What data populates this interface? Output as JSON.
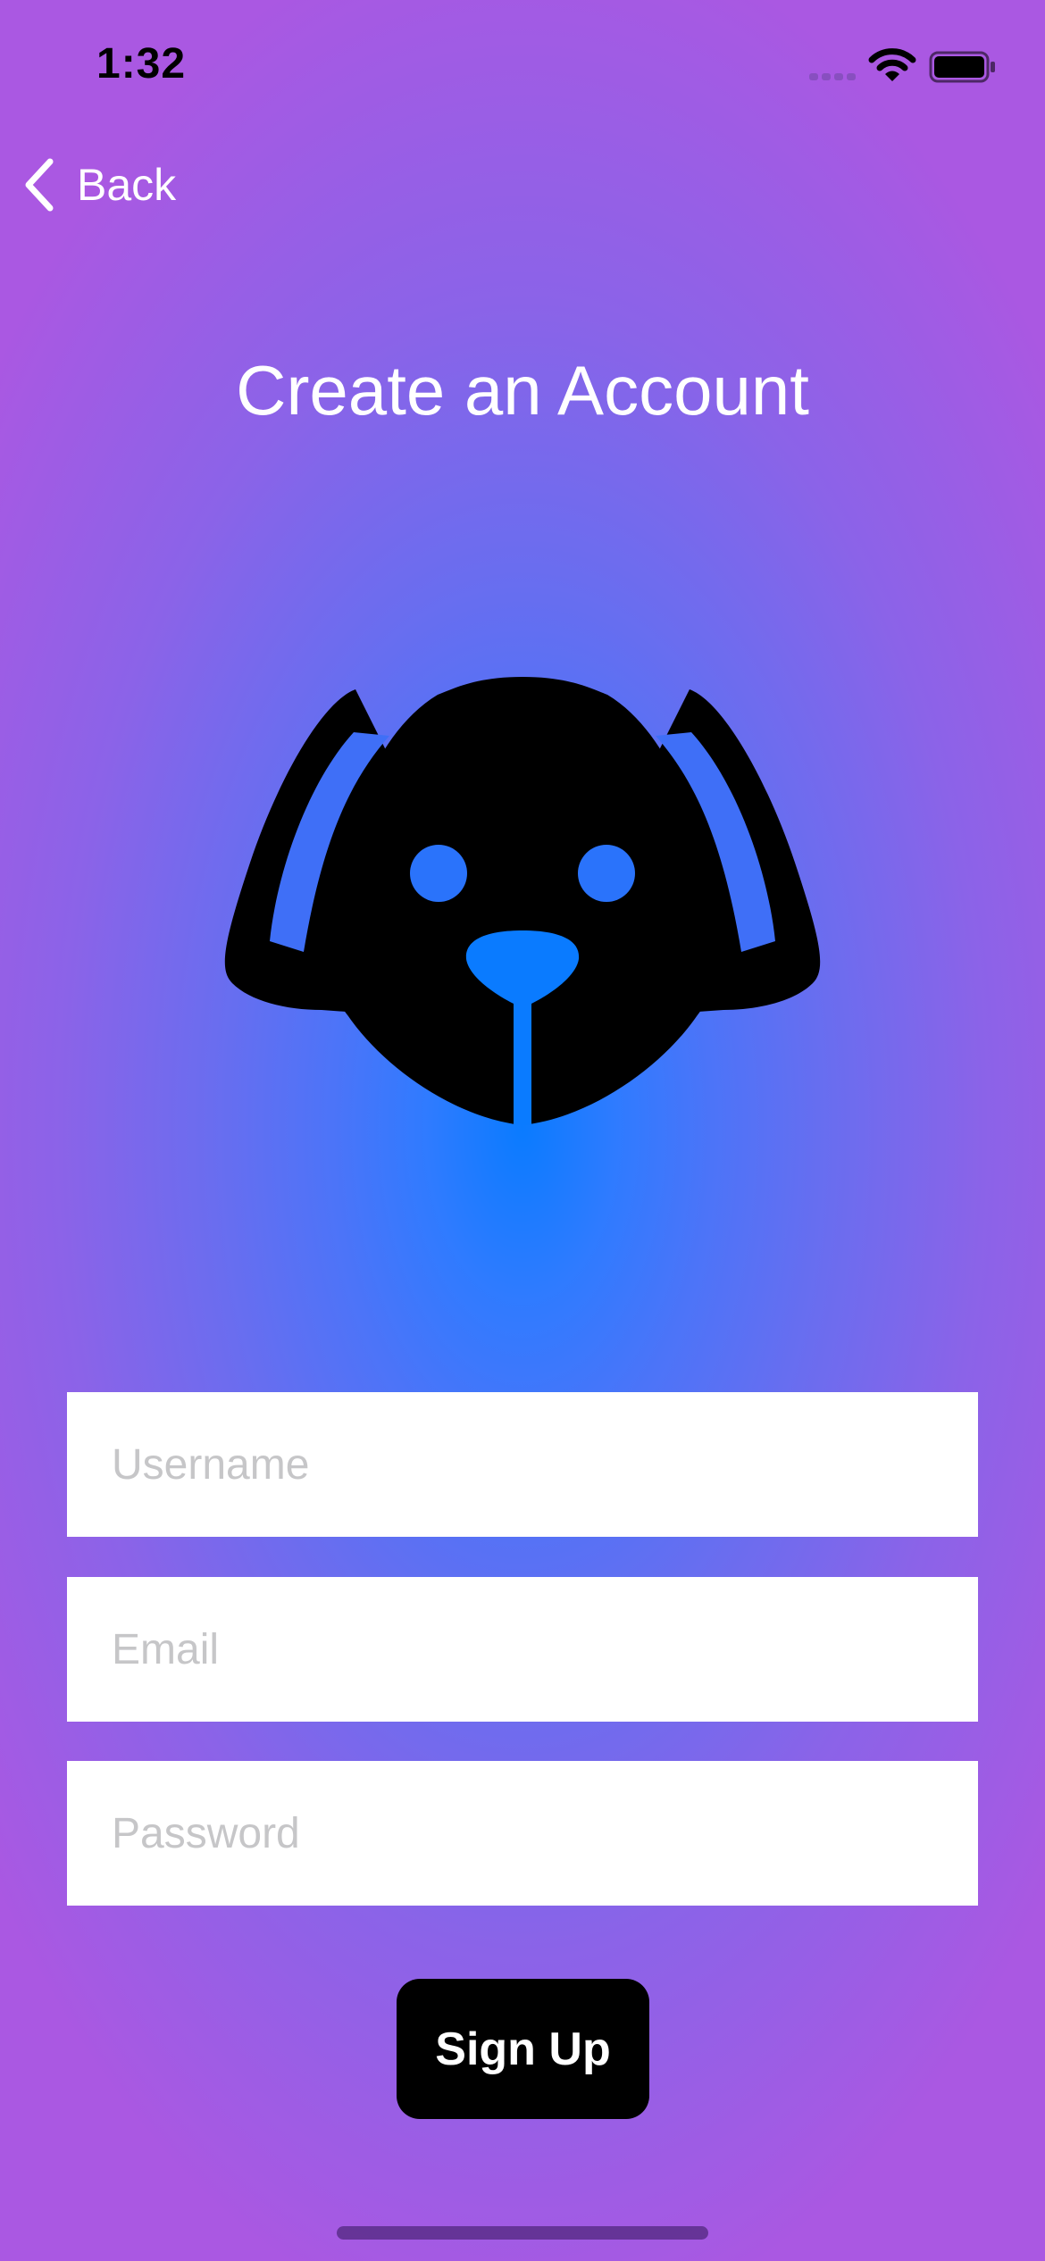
{
  "status_bar": {
    "time": "1:32",
    "icons": [
      "cellular-signal-icon",
      "wifi-icon",
      "battery-icon"
    ]
  },
  "nav": {
    "back_label": "Back",
    "back_icon": "chevron-left-icon"
  },
  "page": {
    "title": "Create an Account",
    "logo_icon": "dog-face-icon"
  },
  "form": {
    "username_placeholder": "Username",
    "username_value": "",
    "email_placeholder": "Email",
    "email_value": "",
    "password_placeholder": "Password",
    "password_value": "",
    "submit_label": "Sign Up"
  },
  "colors": {
    "gradient_center": "#0a7bff",
    "gradient_edge": "#aa58e2",
    "button_background": "#000000",
    "button_text": "#ffffff",
    "logo_fill": "#000000",
    "logo_cutouts": "#0a7bff"
  }
}
